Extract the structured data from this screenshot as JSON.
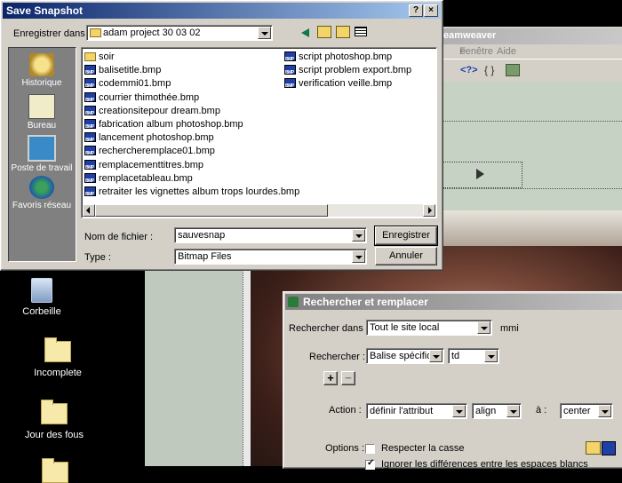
{
  "desktop": {
    "icons": [
      {
        "label": "Corbeille"
      },
      {
        "label": "Incomplete"
      },
      {
        "label": "Jour des fous"
      }
    ]
  },
  "dreamweaver": {
    "title_fragment": "eamweaver",
    "menu": [
      "e",
      "Fenêtre",
      "Aide"
    ],
    "toolbar_code": "<?>"
  },
  "save_dialog": {
    "title": "Save Snapshot",
    "help_btn": "?",
    "close_btn": "×",
    "save_in_label": "Enregistrer dans :",
    "save_in_value": "adam project 30 03 02",
    "places": [
      {
        "label": "Historique"
      },
      {
        "label": "Bureau"
      },
      {
        "label": "Poste de travail"
      },
      {
        "label": "Favoris réseau"
      }
    ],
    "files_col1": [
      {
        "name": "soir",
        "type": "folder"
      },
      {
        "name": "balisetitle.bmp",
        "type": "bmp"
      },
      {
        "name": "codemmi01.bmp",
        "type": "bmp"
      },
      {
        "name": "courrier thimothée.bmp",
        "type": "bmp"
      },
      {
        "name": "creationsitepour dream.bmp",
        "type": "bmp"
      },
      {
        "name": "fabrication album photoshop.bmp",
        "type": "bmp"
      },
      {
        "name": "lancement photoshop.bmp",
        "type": "bmp"
      },
      {
        "name": "rechercheremplace01.bmp",
        "type": "bmp"
      },
      {
        "name": "remplacementtitres.bmp",
        "type": "bmp"
      },
      {
        "name": "remplacetableau.bmp",
        "type": "bmp"
      },
      {
        "name": "retraiter les vignettes album trops lourdes.bmp",
        "type": "bmp"
      }
    ],
    "files_col2": [
      {
        "name": "script photoshop.bmp",
        "type": "bmp"
      },
      {
        "name": "script problem export.bmp",
        "type": "bmp"
      },
      {
        "name": "verification veille.bmp",
        "type": "bmp"
      }
    ],
    "filename_label": "Nom de fichier :",
    "filename_value": "sauvesnap",
    "type_label": "Type :",
    "type_value": "Bitmap Files",
    "save_btn": "Enregistrer",
    "cancel_btn": "Annuler"
  },
  "find_replace": {
    "title": "Rechercher et remplacer",
    "search_in_label": "Rechercher dans :",
    "search_in_value": "Tout le site local",
    "search_in_suffix": "mmi",
    "search_label": "Rechercher :",
    "search_type": "Balise spécifique",
    "search_tag": "td",
    "plus": "+",
    "minus": "−",
    "action_label": "Action :",
    "action_value": "définir l'attribut",
    "attr_value": "align",
    "to_label": "à :",
    "to_value": "center",
    "options_label": "Options :",
    "opt_case": "Respecter la casse",
    "opt_whitespace": "Ignorer les différences entre les espaces blancs"
  }
}
